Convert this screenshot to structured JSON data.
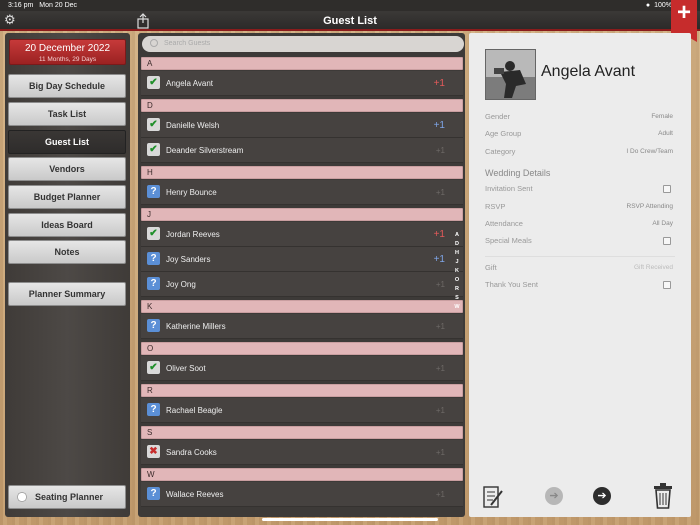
{
  "status_bar": {
    "time": "3:16 pm",
    "date": "Mon 20 Dec",
    "battery": "100%"
  },
  "nav": {
    "title": "Guest List",
    "add_label": "+"
  },
  "sidebar": {
    "date_title": "20 December 2022",
    "date_sub": "11 Months, 29 Days",
    "items": [
      {
        "label": "Big Day Schedule"
      },
      {
        "label": "Task List"
      },
      {
        "label": "Guest List"
      },
      {
        "label": "Vendors"
      },
      {
        "label": "Budget Planner"
      },
      {
        "label": "Ideas Board"
      },
      {
        "label": "Notes"
      }
    ],
    "planner_summary": "Planner Summary",
    "seating_planner": "Seating Planner"
  },
  "guests": {
    "search_placeholder": "Search Guests",
    "sections": [
      {
        "letter": "A",
        "rows": [
          {
            "name": "Angela Avant",
            "status": "check",
            "plus": "+1",
            "plus_style": "red"
          }
        ]
      },
      {
        "letter": "D",
        "rows": [
          {
            "name": "Danielle Welsh",
            "status": "check",
            "plus": "+1",
            "plus_style": "blue"
          },
          {
            "name": "Deander  Silverstream",
            "status": "check",
            "plus": "+1",
            "plus_style": "dim"
          }
        ]
      },
      {
        "letter": "H",
        "rows": [
          {
            "name": "Henry Bounce",
            "status": "question",
            "plus": "+1",
            "plus_style": "dim"
          }
        ]
      },
      {
        "letter": "J",
        "rows": [
          {
            "name": "Jordan Reeves",
            "status": "check",
            "plus": "+1",
            "plus_style": "red"
          },
          {
            "name": "Joy Sanders",
            "status": "question",
            "plus": "+1",
            "plus_style": "blue"
          },
          {
            "name": "Joy Ong",
            "status": "question",
            "plus": "+1",
            "plus_style": "dim"
          }
        ]
      },
      {
        "letter": "K",
        "rows": [
          {
            "name": "Katherine Millers",
            "status": "question",
            "plus": "+1",
            "plus_style": "dim"
          }
        ]
      },
      {
        "letter": "O",
        "rows": [
          {
            "name": "Oliver Soot",
            "status": "check",
            "plus": "+1",
            "plus_style": "dim"
          }
        ]
      },
      {
        "letter": "R",
        "rows": [
          {
            "name": "Rachael Beagle",
            "status": "question",
            "plus": "+1",
            "plus_style": "dim"
          }
        ]
      },
      {
        "letter": "S",
        "rows": [
          {
            "name": "Sandra Cooks",
            "status": "x",
            "plus": "+1",
            "plus_style": "dim"
          }
        ]
      },
      {
        "letter": "W",
        "rows": [
          {
            "name": "Wallace Reeves",
            "status": "question",
            "plus": "+1",
            "plus_style": "dim"
          }
        ]
      }
    ],
    "index_letters": [
      "A",
      "D",
      "H",
      "J",
      "K",
      "O",
      "R",
      "S",
      "W"
    ]
  },
  "detail": {
    "name": "Angela Avant",
    "gender_label": "Gender",
    "gender_value": "Female",
    "age_label": "Age Group",
    "age_value": "Adult",
    "category_label": "Category",
    "category_value": "I Do Crew/Team",
    "wedding_title": "Wedding Details",
    "invitation_label": "Invitation Sent",
    "rsvp_label": "RSVP",
    "rsvp_value": "RSVP Attending",
    "attendance_label": "Attendance",
    "attendance_value": "All Day",
    "meals_label": "Special Meals",
    "gift_label": "Gift",
    "gift_value": "Gift Received",
    "thankyou_label": "Thank You Sent"
  }
}
